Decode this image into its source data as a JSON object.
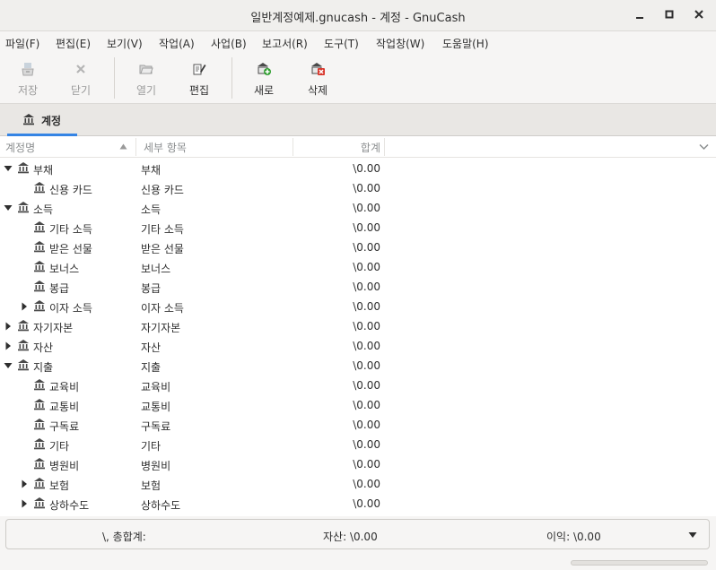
{
  "window": {
    "title": "일반계정예제.gnucash - 계정 - GnuCash"
  },
  "menubar": {
    "items": [
      "파일(F)",
      "편집(E)",
      "보기(V)",
      "작업(A)",
      "사업(B)",
      "보고서(R)",
      "도구(T)",
      "작업창(W)",
      "도움말(H)"
    ]
  },
  "toolbar": {
    "save": {
      "label": "저장",
      "icon": "save-icon",
      "enabled": false
    },
    "close": {
      "label": "닫기",
      "icon": "close-icon",
      "enabled": false
    },
    "open": {
      "label": "열기",
      "icon": "open-folder-icon",
      "enabled": false
    },
    "edit": {
      "label": "편집",
      "icon": "edit-icon",
      "enabled": true
    },
    "new": {
      "label": "새로",
      "icon": "new-account-icon",
      "enabled": true
    },
    "delete": {
      "label": "삭제",
      "icon": "delete-account-icon",
      "enabled": true
    }
  },
  "tabs": [
    {
      "label": "계정",
      "icon": "bank-icon",
      "active": true
    }
  ],
  "tree": {
    "columns": {
      "name": "계정명",
      "description": "세부 항목",
      "total": "합계"
    },
    "rows": [
      {
        "name": "부채",
        "description": "부채",
        "total": "\\0.00",
        "level": 0,
        "expander": "expanded"
      },
      {
        "name": "신용 카드",
        "description": "신용 카드",
        "total": "\\0.00",
        "level": 1,
        "expander": "none"
      },
      {
        "name": "소득",
        "description": "소득",
        "total": "\\0.00",
        "level": 0,
        "expander": "expanded"
      },
      {
        "name": "기타 소득",
        "description": "기타 소득",
        "total": "\\0.00",
        "level": 1,
        "expander": "none"
      },
      {
        "name": "받은 선물",
        "description": "받은 선물",
        "total": "\\0.00",
        "level": 1,
        "expander": "none"
      },
      {
        "name": "보너스",
        "description": "보너스",
        "total": "\\0.00",
        "level": 1,
        "expander": "none"
      },
      {
        "name": "봉급",
        "description": "봉급",
        "total": "\\0.00",
        "level": 1,
        "expander": "none"
      },
      {
        "name": "이자 소득",
        "description": "이자 소득",
        "total": "\\0.00",
        "level": 1,
        "expander": "collapsed"
      },
      {
        "name": "자기자본",
        "description": "자기자본",
        "total": "\\0.00",
        "level": 0,
        "expander": "collapsed"
      },
      {
        "name": "자산",
        "description": "자산",
        "total": "\\0.00",
        "level": 0,
        "expander": "collapsed"
      },
      {
        "name": "지출",
        "description": "지출",
        "total": "\\0.00",
        "level": 0,
        "expander": "expanded"
      },
      {
        "name": "교육비",
        "description": "교육비",
        "total": "\\0.00",
        "level": 1,
        "expander": "none"
      },
      {
        "name": "교통비",
        "description": "교통비",
        "total": "\\0.00",
        "level": 1,
        "expander": "none"
      },
      {
        "name": "구독료",
        "description": "구독료",
        "total": "\\0.00",
        "level": 1,
        "expander": "none"
      },
      {
        "name": "기타",
        "description": "기타",
        "total": "\\0.00",
        "level": 1,
        "expander": "none"
      },
      {
        "name": "병원비",
        "description": "병원비",
        "total": "\\0.00",
        "level": 1,
        "expander": "none"
      },
      {
        "name": "보험",
        "description": "보험",
        "total": "\\0.00",
        "level": 1,
        "expander": "collapsed"
      },
      {
        "name": "상하수도",
        "description": "상하수도",
        "total": "\\0.00",
        "level": 1,
        "expander": "collapsed"
      }
    ]
  },
  "summary": {
    "currency_total": "\\, 총합계:",
    "assets": "자산: \\0.00",
    "profit": "이익: \\0.00"
  },
  "colors": {
    "accent": "#3584e4",
    "account_icon": "#4a4a4a"
  }
}
